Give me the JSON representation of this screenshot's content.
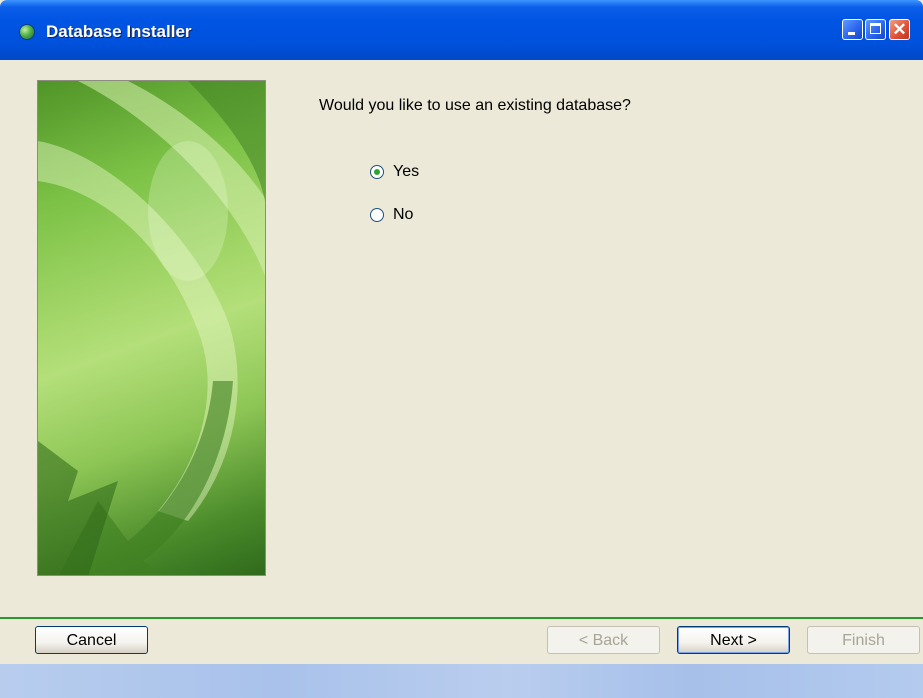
{
  "window": {
    "title": "Database Installer",
    "title_icon": "globe-icon",
    "controls": [
      "minimize-icon",
      "maximize-icon",
      "close-icon"
    ]
  },
  "wizard": {
    "question": "Would you like to use an existing database?",
    "options": [
      {
        "label": "Yes",
        "checked": true
      },
      {
        "label": "No",
        "checked": false
      }
    ]
  },
  "buttons": {
    "cancel": "Cancel",
    "back": "< Back",
    "next": "Next >",
    "finish": "Finish"
  },
  "colors": {
    "titlebar": "#0054e3",
    "dialog_bg": "#ece9d8",
    "separator": "#2a9a2a",
    "radio_dot": "#2da42d"
  }
}
